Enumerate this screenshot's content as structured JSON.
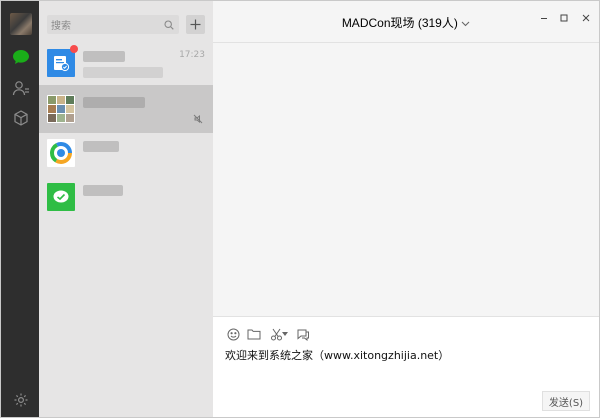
{
  "search": {
    "placeholder": "搜索"
  },
  "sessions": [
    {
      "time": "17:23"
    }
  ],
  "chat": {
    "title": "MADCon现场 (319人)",
    "composer_text": "欢迎来到系统之家（www.xitongzhijia.net）",
    "send_label": "发送(S)"
  },
  "icons": {
    "rail": [
      "avatar",
      "chat-icon",
      "contacts-icon",
      "cube-icon",
      "settings-icon"
    ],
    "toolbar": [
      "emoji-icon",
      "folder-icon",
      "scissors-icon",
      "chevron-down-icon",
      "chat-history-icon"
    ],
    "window": [
      "minimize-icon",
      "maximize-icon",
      "close-icon"
    ]
  },
  "colors": {
    "rail_bg": "#2e2e2e",
    "list_bg": "#e6e5e5",
    "selected_bg": "#c9c8c8",
    "chat_bg": "#f5f5f5",
    "accent_green": "#2fbd45",
    "badge_red": "#f74c4c"
  }
}
